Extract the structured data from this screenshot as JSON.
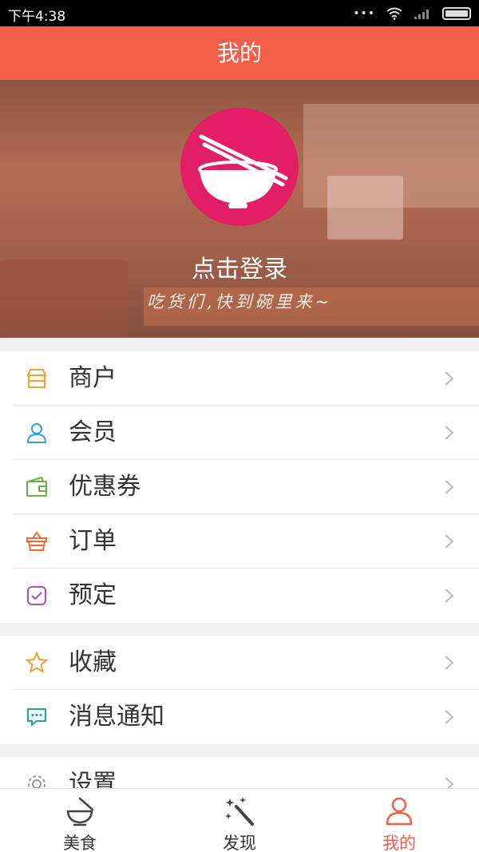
{
  "status_bar": {
    "time": "下午4:38",
    "dots": "•••"
  },
  "header": {
    "title": "我的"
  },
  "profile": {
    "login_label": "点击登录",
    "slogan": "吃货们,快到碗里来~"
  },
  "menu_group_1": [
    {
      "label": "商户",
      "icon": "shop-icon"
    },
    {
      "label": "会员",
      "icon": "user-icon"
    },
    {
      "label": "优惠券",
      "icon": "wallet-icon"
    },
    {
      "label": "订单",
      "icon": "basket-icon"
    },
    {
      "label": "预定",
      "icon": "calendar-check-icon"
    }
  ],
  "menu_group_2": [
    {
      "label": "收藏",
      "icon": "star-icon"
    },
    {
      "label": "消息通知",
      "icon": "message-icon"
    }
  ],
  "menu_group_3": [
    {
      "label": "设置",
      "icon": "gear-icon"
    }
  ],
  "tabbar": [
    {
      "label": "美食",
      "icon": "bowl-icon"
    },
    {
      "label": "发现",
      "icon": "magic-wand-icon"
    },
    {
      "label": "我的",
      "icon": "person-icon",
      "active": true
    }
  ],
  "colors": {
    "accent": "#f25e4a",
    "avatar": "#e21e64"
  }
}
